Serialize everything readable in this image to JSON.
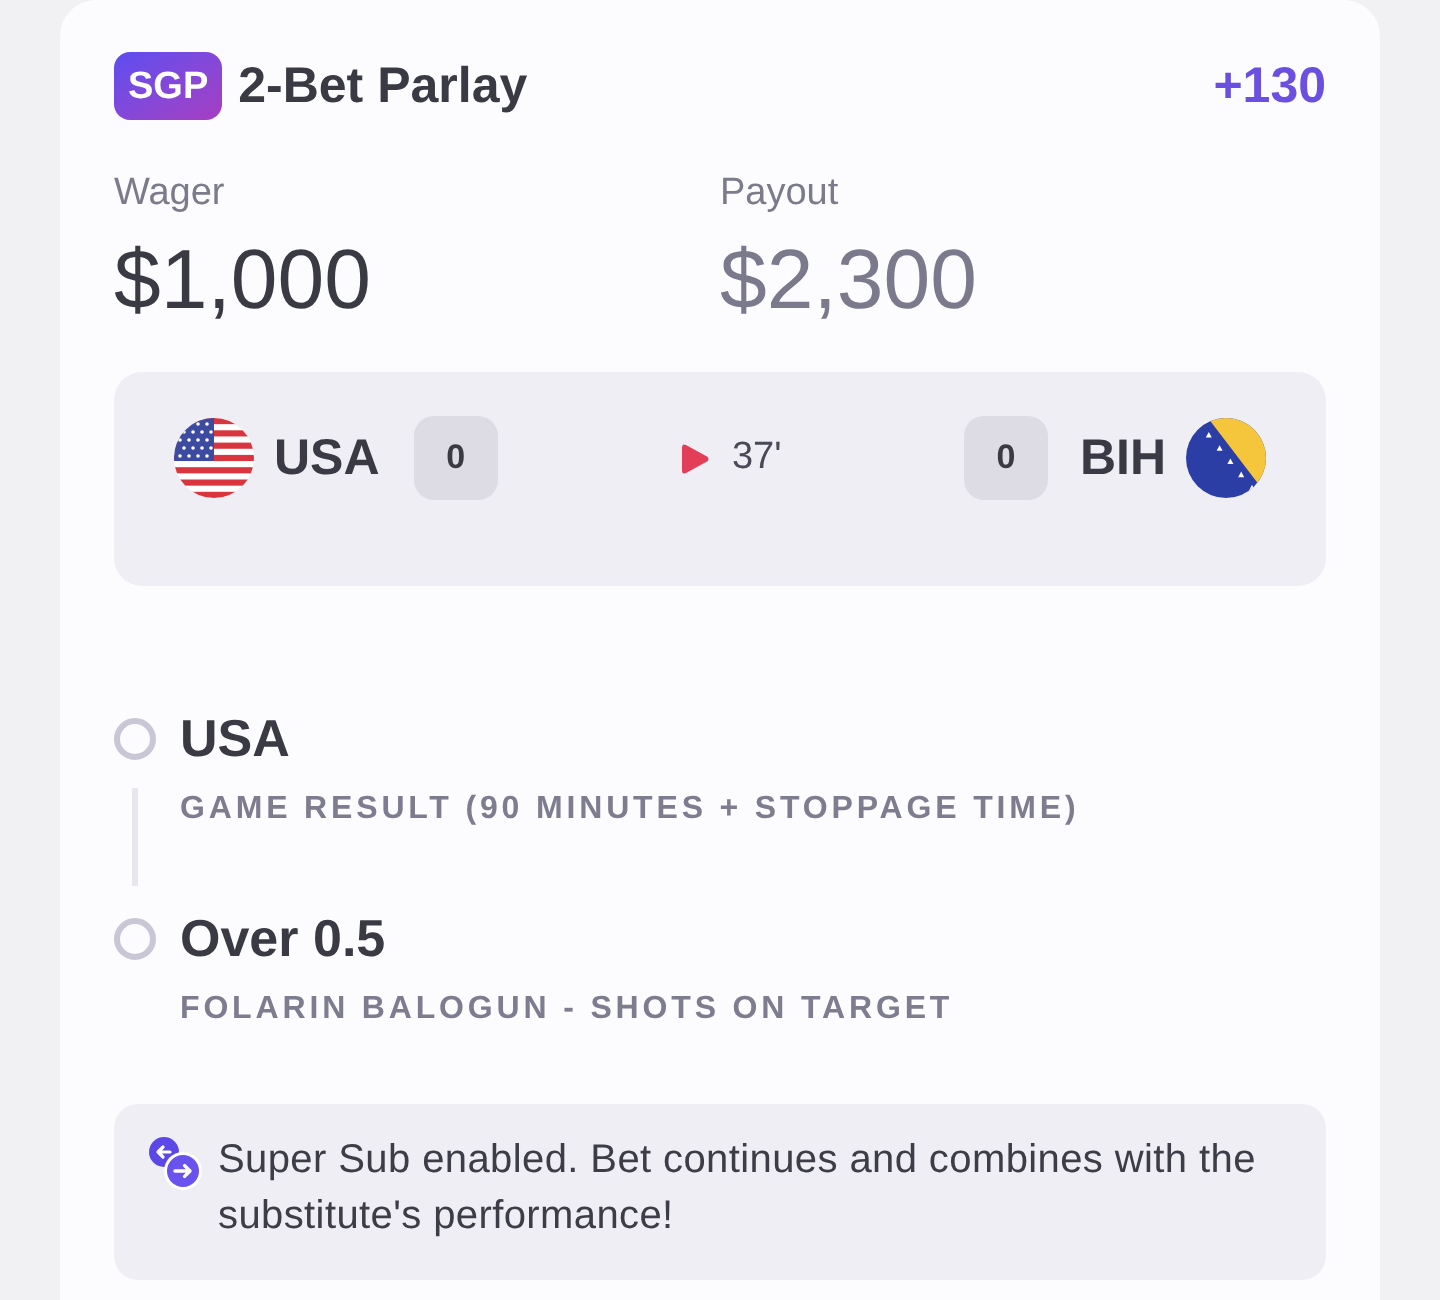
{
  "header": {
    "badge": "SGP",
    "title": "2-Bet Parlay",
    "odds": "+130"
  },
  "amounts": [
    {
      "kind": "wager",
      "label": "Wager",
      "value": "$1,000"
    },
    {
      "kind": "payout",
      "label": "Payout",
      "value": "$2,300"
    }
  ],
  "match": {
    "home": {
      "name": "USA",
      "score": "0"
    },
    "live": true,
    "clock": "37'",
    "away": {
      "name": "BIH",
      "score": "0"
    }
  },
  "legs": [
    {
      "selection": "USA",
      "market": "GAME RESULT (90 MINUTES + STOPPAGE TIME)"
    },
    {
      "selection": "Over 0.5",
      "market": "FOLARIN BALOGUN - SHOTS ON TARGET"
    }
  ],
  "notice": {
    "text": "Super Sub enabled. Bet continues and combines with the substitute's performance!"
  }
}
